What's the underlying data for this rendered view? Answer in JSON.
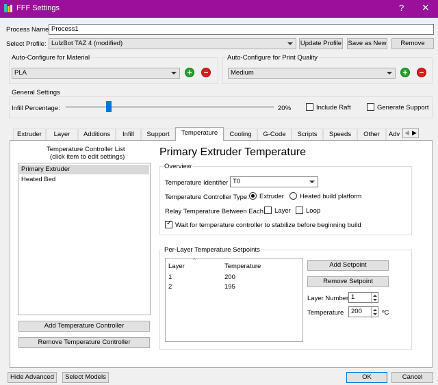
{
  "window": {
    "title": "FFF Settings",
    "help": "?",
    "close": "✕"
  },
  "process": {
    "label": "Process Name:",
    "value": "Process1"
  },
  "profile": {
    "label": "Select Profile:",
    "value": "LulzBot TAZ 4 (modified)",
    "update": "Update Profile",
    "save_as_new": "Save as New",
    "remove": "Remove"
  },
  "material": {
    "label": "Auto-Configure for Material",
    "value": "PLA"
  },
  "quality": {
    "label": "Auto-Configure for Print Quality",
    "value": "Medium"
  },
  "general": {
    "label": "General Settings",
    "infill_label": "Infill Percentage:",
    "infill_value": "20%",
    "infill_fraction": 0.2,
    "include_raft": "Include Raft",
    "generate_support": "Generate Support"
  },
  "tabs": [
    "Extruder",
    "Layer",
    "Additions",
    "Infill",
    "Support",
    "Temperature",
    "Cooling",
    "G-Code",
    "Scripts",
    "Speeds",
    "Other",
    "Adv"
  ],
  "active_tab": "Temperature",
  "controller_list": {
    "title": "Temperature Controller List",
    "subtitle": "(click item to edit settings)",
    "items": [
      "Primary Extruder",
      "Heated Bed"
    ],
    "add": "Add Temperature Controller",
    "remove": "Remove Temperature Controller"
  },
  "panel": {
    "heading": "Primary Extruder Temperature",
    "overview": "Overview",
    "identifier_label": "Temperature Identifier",
    "identifier_value": "T0",
    "type_label": "Temperature Controller Type:",
    "type_extruder": "Extruder",
    "type_platform": "Heated build platform",
    "relay_label": "Relay Temperature Between Each:",
    "relay_layer": "Layer",
    "relay_loop": "Loop",
    "wait_label": "Wait for temperature controller to stabilize before beginning build"
  },
  "setpoints": {
    "title": "Per-Layer Temperature Setpoints",
    "col_layer": "Layer",
    "col_temp": "Temperature",
    "rows": [
      {
        "layer": "1",
        "temp": "200"
      },
      {
        "layer": "2",
        "temp": "195"
      }
    ],
    "add": "Add Setpoint",
    "remove": "Remove Setpoint",
    "layer_number_label": "Layer Number",
    "layer_number_value": "1",
    "temperature_label": "Temperature",
    "temperature_value": "200",
    "unit": "ºC"
  },
  "footer": {
    "hide_advanced": "Hide Advanced",
    "select_models": "Select Models",
    "ok": "OK",
    "cancel": "Cancel"
  },
  "colors": {
    "titlebar": "#9b109b",
    "accent": "#0078d7",
    "add": "#22a32c",
    "remove": "#e01b1b"
  }
}
